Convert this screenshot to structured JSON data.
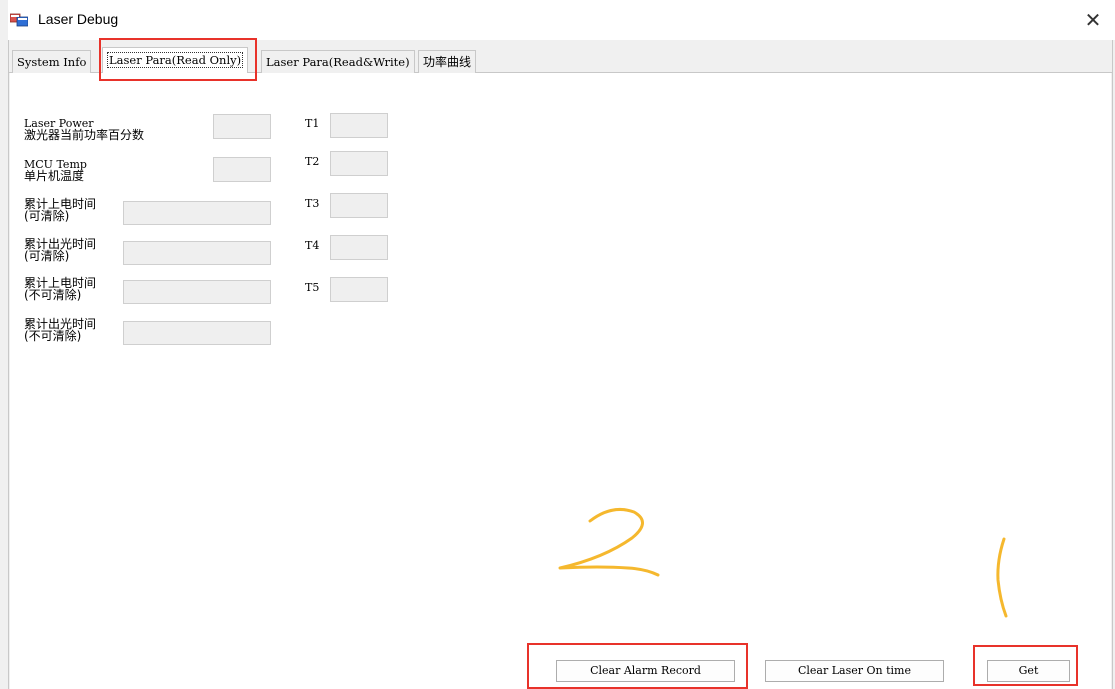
{
  "window": {
    "title": "Laser Debug",
    "close_glyph": "✕"
  },
  "tabs": [
    {
      "label": "System Info"
    },
    {
      "label": "Laser Para(Read Only)"
    },
    {
      "label": "Laser Para(Read&Write)"
    },
    {
      "label": "功率曲线"
    }
  ],
  "fields": {
    "laser_power": {
      "line1": "Laser Power",
      "line2": "激光器当前功率百分数",
      "value": ""
    },
    "mcu_temp": {
      "line1": "MCU Temp",
      "line2": "单片机温度",
      "value": ""
    },
    "power_on_time_clearable": {
      "line1": "累计上电时间",
      "line2": "(可清除)",
      "value": ""
    },
    "laser_on_time_clearable": {
      "line1": "累计出光时间",
      "line2": "(可清除)",
      "value": ""
    },
    "power_on_time_permanent": {
      "line1": "累计上电时间",
      "line2": "(不可清除)",
      "value": ""
    },
    "laser_on_time_permanent": {
      "line1": "累计出光时间",
      "line2": "(不可清除)",
      "value": ""
    }
  },
  "temps": [
    {
      "label": "T1",
      "value": ""
    },
    {
      "label": "T2",
      "value": ""
    },
    {
      "label": "T3",
      "value": ""
    },
    {
      "label": "T4",
      "value": ""
    },
    {
      "label": "T5",
      "value": ""
    }
  ],
  "buttons": {
    "clear_alarm": "Clear Alarm Record",
    "clear_laser_on": "Clear Laser On time",
    "get": "Get"
  },
  "annotations": {
    "step1": "1",
    "step2": "2",
    "highlight_color": "#e8322a",
    "ink_color": "#f5b82e"
  }
}
